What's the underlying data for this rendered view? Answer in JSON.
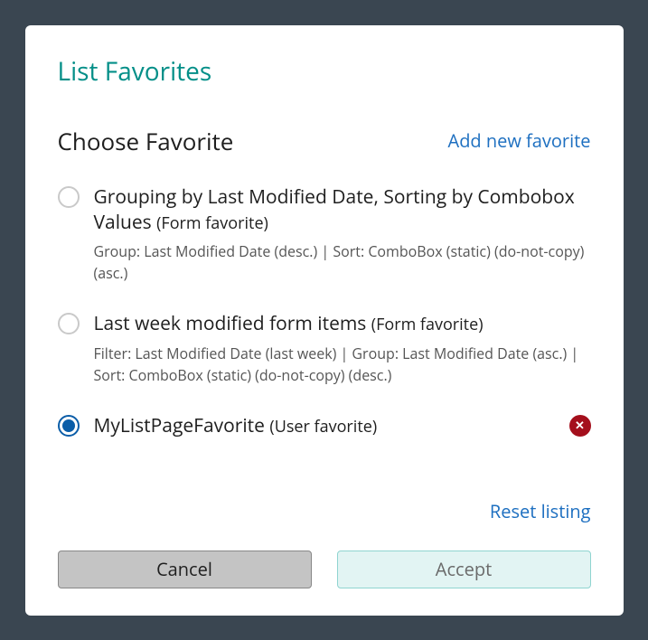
{
  "dialog": {
    "title": "List Favorites",
    "section_title": "Choose Favorite",
    "add_new_label": "Add new favorite",
    "reset_label": "Reset listing",
    "cancel_label": "Cancel",
    "accept_label": "Accept"
  },
  "favorites": [
    {
      "title": "Grouping by Last Modified Date, Sorting by Combobox Values",
      "scope": "(Form favorite)",
      "desc": "Group: Last Modified Date (desc.) | Sort: ComboBox (static) (do-not-copy) (asc.)",
      "selected": false,
      "deletable": false
    },
    {
      "title": "Last week modified form items",
      "scope": "(Form favorite)",
      "desc": "Filter: Last Modified Date (last week) | Group: Last Modified Date (asc.) | Sort: ComboBox (static) (do-not-copy) (desc.)",
      "selected": false,
      "deletable": false
    },
    {
      "title": "MyListPageFavorite",
      "scope": "(User favorite)",
      "desc": "",
      "selected": true,
      "deletable": true
    }
  ]
}
